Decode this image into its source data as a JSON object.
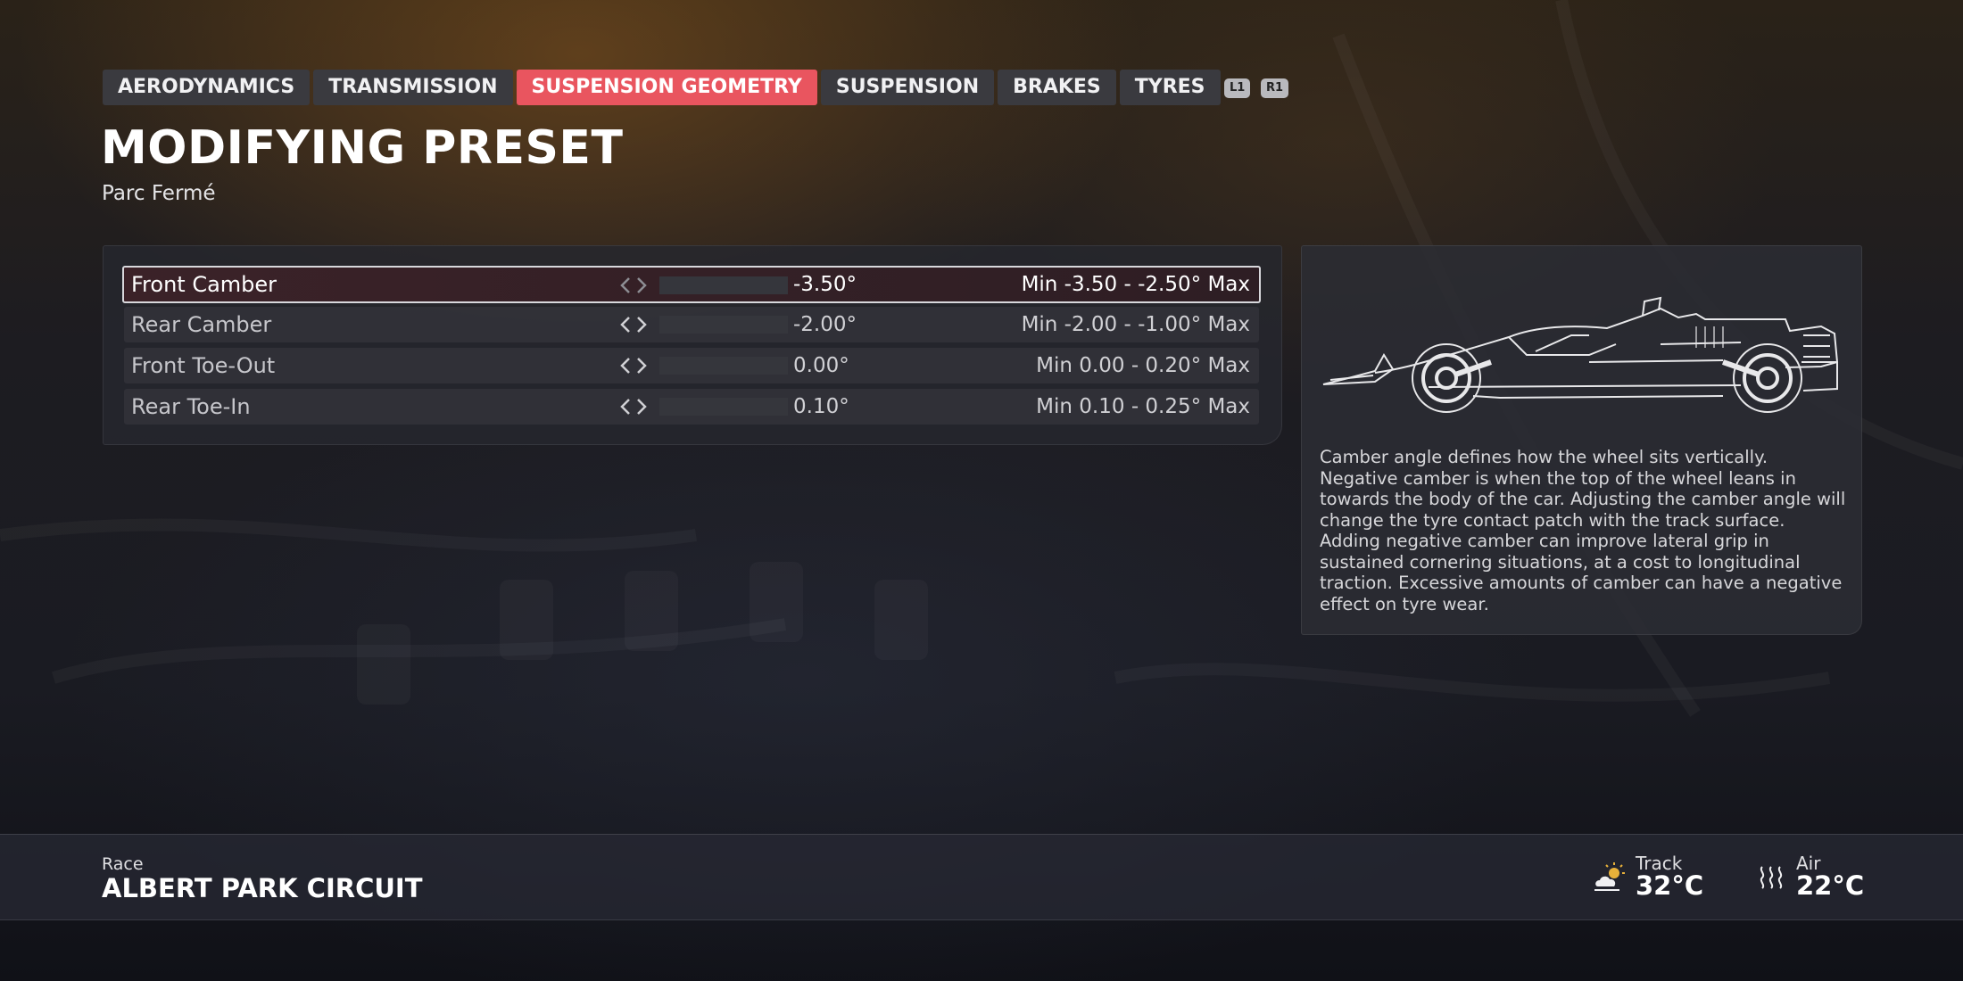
{
  "tabs": [
    {
      "label": "AERODYNAMICS",
      "active": false
    },
    {
      "label": "TRANSMISSION",
      "active": false
    },
    {
      "label": "SUSPENSION GEOMETRY",
      "active": true
    },
    {
      "label": "SUSPENSION",
      "active": false
    },
    {
      "label": "BRAKES",
      "active": false
    },
    {
      "label": "TYRES",
      "active": false
    }
  ],
  "shoulder_buttons": {
    "left": "L1",
    "right": "R1"
  },
  "header": {
    "title": "MODIFYING PRESET",
    "subtitle": "Parc Fermé"
  },
  "settings": [
    {
      "label": "Front Camber",
      "value": "-3.50°",
      "range": "Min -3.50 - -2.50° Max",
      "fill": 0.0,
      "selected": true
    },
    {
      "label": "Rear Camber",
      "value": "-2.00°",
      "range": "Min -2.00 - -1.00° Max",
      "fill": 0.0,
      "selected": false
    },
    {
      "label": "Front Toe-Out",
      "value": "0.00°",
      "range": "Min 0.00 - 0.20° Max",
      "fill": 0.0,
      "selected": false
    },
    {
      "label": "Rear Toe-In",
      "value": "0.10°",
      "range": "Min 0.10 - 0.25° Max",
      "fill": 0.0,
      "selected": false
    }
  ],
  "info": {
    "description": "Camber angle defines how the wheel sits vertically. Negative camber is when the top of the wheel leans in towards the body of the car. Adjusting the camber angle will change the tyre contact patch with the track surface. Adding negative camber can improve lateral grip in sustained cornering situations, at a cost to longitudinal traction. Excessive amounts of camber can have a negative effect on tyre wear."
  },
  "footer": {
    "session": "Race",
    "circuit": "ALBERT PARK CIRCUIT",
    "track_label": "Track",
    "track_temp": "32°C",
    "air_label": "Air",
    "air_temp": "22°C"
  },
  "colors": {
    "accent": "#e9555f",
    "tab_bg": "#3a3a3f"
  },
  "icons": {
    "track": "partly-cloudy-sun-icon",
    "air": "heat-waves-icon"
  }
}
